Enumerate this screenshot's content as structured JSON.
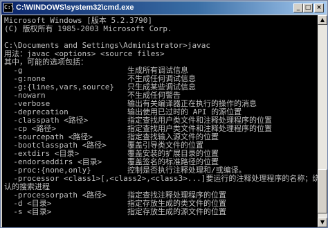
{
  "window": {
    "title": "C:\\WINDOWS\\system32\\cmd.exe",
    "icon_name": "cmd-icon",
    "buttons": {
      "minimize": "_",
      "maximize": "□",
      "close": "×"
    }
  },
  "console": {
    "header": [
      "Microsoft Windows [版本 5.2.3790]",
      "(C) 版权所有 1985-2003 Microsoft Corp.",
      "",
      "C:\\Documents and Settings\\Administrator>javac",
      "用法：javac <options> <source files>",
      "其中，可能的选项包括："
    ],
    "options": [
      {
        "opt": "  -g",
        "desc": "生成所有调试信息"
      },
      {
        "opt": "  -g:none",
        "desc": "不生成任何调试信息"
      },
      {
        "opt": "  -g:{lines,vars,source}",
        "desc": "只生成某些调试信息"
      },
      {
        "opt": "  -nowarn",
        "desc": "不生成任何警告"
      },
      {
        "opt": "  -verbose",
        "desc": "输出有关编译器正在执行的操作的消息"
      },
      {
        "opt": "  -deprecation",
        "desc": "输出使用已过时的 API 的源位置"
      },
      {
        "opt": "  -classpath <路径>",
        "desc": "指定查找用户类文件和注释处理程序的位置"
      },
      {
        "opt": "  -cp <路径>",
        "desc": "指定查找用户类文件和注释处理程序的位置"
      },
      {
        "opt": "  -sourcepath <路径>",
        "desc": "指定查找输入源文件的位置"
      },
      {
        "opt": "  -bootclasspath <路径>",
        "desc": "覆盖引导类文件的位置"
      },
      {
        "opt": "  -extdirs <目录>",
        "desc": "覆盖安装的扩展目录的位置"
      },
      {
        "opt": "  -endorseddirs <目录>",
        "desc": "覆盖签名的标准路径的位置"
      },
      {
        "opt": "  -proc:{none,only}",
        "desc": "控制是否执行注释处理和/或编译。"
      }
    ],
    "processor_line": "  -processor <class1>[,<class2>,<class3>...]要运行的注释处理程序的名称；绕",
    "processor_cont": "认的搜索进程",
    "options2": [
      {
        "opt": "  -processorpath <路径>",
        "desc": "指定查找注释处理程序的位置"
      },
      {
        "opt": "  -d <目录>",
        "desc": "指定存放生成的类文件的位置"
      },
      {
        "opt": "  -s <目录>",
        "desc": "指定存放生成的源文件的位置"
      }
    ]
  },
  "scrollbar": {
    "up": "▲",
    "down": "▼"
  }
}
